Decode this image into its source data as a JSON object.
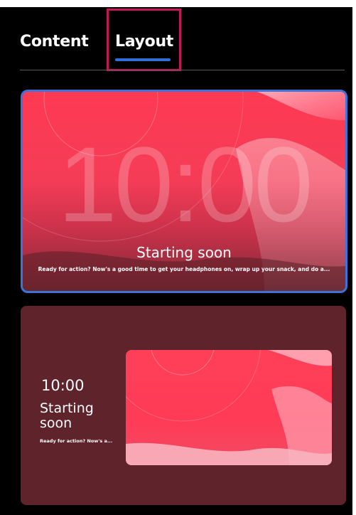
{
  "tabs": [
    {
      "label": "Content",
      "selected": false
    },
    {
      "label": "Layout",
      "selected": true
    }
  ],
  "accent_color": "#2f6fd6",
  "highlight_color": "#c2185b",
  "layouts": [
    {
      "selected": true,
      "clock": "10:00",
      "headline": "Starting soon",
      "subline": "Ready for action? Now's a good time to get your headphones on, wrap up your snack, and do a..."
    },
    {
      "selected": false,
      "clock": "10:00",
      "headline": "Starting soon",
      "subline": "Ready for action? Now's a..."
    }
  ]
}
